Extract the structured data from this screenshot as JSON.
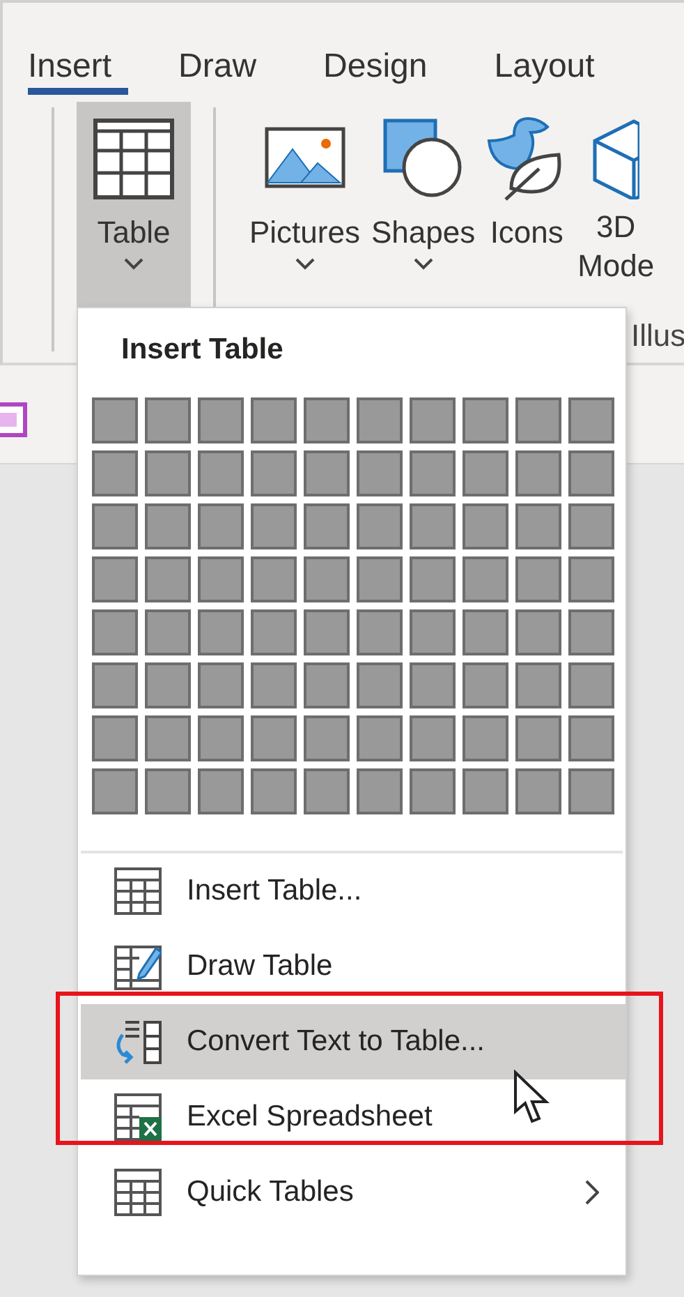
{
  "tabs": [
    {
      "label": "Insert",
      "selected": true
    },
    {
      "label": "Draw",
      "selected": false
    },
    {
      "label": "Design",
      "selected": false
    },
    {
      "label": "Layout",
      "selected": false
    }
  ],
  "ribbon": {
    "buttons": [
      {
        "kind": "table",
        "label": "Table",
        "dropdown": true,
        "selected": true
      },
      {
        "kind": "pictures",
        "label": "Pictures",
        "dropdown": true,
        "selected": false
      },
      {
        "kind": "shapes",
        "label": "Shapes",
        "dropdown": true,
        "selected": false
      },
      {
        "kind": "icons",
        "label": "Icons",
        "dropdown": false,
        "selected": false
      },
      {
        "kind": "models",
        "label": "3D Mode",
        "dropdown": false,
        "selected": false
      }
    ],
    "group_label": "Illus"
  },
  "dropdown": {
    "title": "Insert Table",
    "grid": [
      [
        {
          "selected": false
        },
        {
          "selected": false
        },
        {
          "selected": false
        },
        {
          "selected": false
        },
        {
          "selected": false
        },
        {
          "selected": false
        },
        {
          "selected": false
        },
        {
          "selected": false
        },
        {
          "selected": false
        },
        {
          "selected": false
        }
      ],
      [
        {
          "selected": false
        },
        {
          "selected": false
        },
        {
          "selected": false
        },
        {
          "selected": false
        },
        {
          "selected": false
        },
        {
          "selected": false
        },
        {
          "selected": false
        },
        {
          "selected": false
        },
        {
          "selected": false
        },
        {
          "selected": false
        }
      ],
      [
        {
          "selected": false
        },
        {
          "selected": false
        },
        {
          "selected": false
        },
        {
          "selected": false
        },
        {
          "selected": false
        },
        {
          "selected": false
        },
        {
          "selected": false
        },
        {
          "selected": false
        },
        {
          "selected": false
        },
        {
          "selected": false
        }
      ],
      [
        {
          "selected": false
        },
        {
          "selected": false
        },
        {
          "selected": false
        },
        {
          "selected": false
        },
        {
          "selected": false
        },
        {
          "selected": false
        },
        {
          "selected": false
        },
        {
          "selected": false
        },
        {
          "selected": false
        },
        {
          "selected": false
        }
      ],
      [
        {
          "selected": false
        },
        {
          "selected": false
        },
        {
          "selected": false
        },
        {
          "selected": false
        },
        {
          "selected": false
        },
        {
          "selected": false
        },
        {
          "selected": false
        },
        {
          "selected": false
        },
        {
          "selected": false
        },
        {
          "selected": false
        }
      ],
      [
        {
          "selected": false
        },
        {
          "selected": false
        },
        {
          "selected": false
        },
        {
          "selected": false
        },
        {
          "selected": false
        },
        {
          "selected": false
        },
        {
          "selected": false
        },
        {
          "selected": false
        },
        {
          "selected": false
        },
        {
          "selected": false
        }
      ],
      [
        {
          "selected": false
        },
        {
          "selected": false
        },
        {
          "selected": false
        },
        {
          "selected": false
        },
        {
          "selected": false
        },
        {
          "selected": false
        },
        {
          "selected": false
        },
        {
          "selected": false
        },
        {
          "selected": false
        },
        {
          "selected": false
        }
      ],
      [
        {
          "selected": false
        },
        {
          "selected": false
        },
        {
          "selected": false
        },
        {
          "selected": false
        },
        {
          "selected": false
        },
        {
          "selected": false
        },
        {
          "selected": false
        },
        {
          "selected": false
        },
        {
          "selected": false
        },
        {
          "selected": false
        }
      ]
    ],
    "items": [
      {
        "kind": "insert",
        "label": "Insert Table...",
        "selected": false,
        "submenu": false
      },
      {
        "kind": "draw",
        "label": "Draw Table",
        "selected": false,
        "submenu": false
      },
      {
        "kind": "convert",
        "label": "Convert Text to Table...",
        "selected": true,
        "submenu": false
      },
      {
        "kind": "excel",
        "label": "Excel Spreadsheet",
        "selected": false,
        "submenu": false
      },
      {
        "kind": "quick",
        "label": "Quick Tables",
        "selected": false,
        "submenu": true
      }
    ]
  }
}
